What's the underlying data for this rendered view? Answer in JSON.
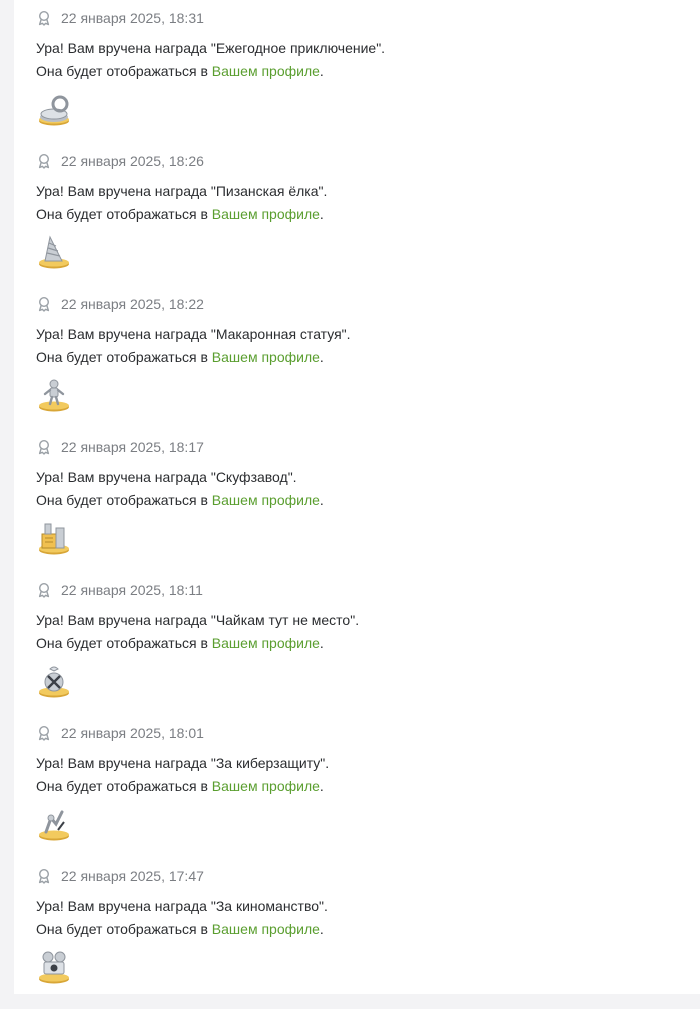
{
  "colors": {
    "link": "#5a9e2f",
    "date": "#7b7e83",
    "text": "#2b2d30",
    "page_bg": "#f3f3f5",
    "panel_bg": "#ffffff"
  },
  "notifications": [
    {
      "date": "22 января 2025, 18:31",
      "message": "Ура! Вам вручена награда \"Ежегодное приключение\".",
      "profile_prefix": "Она будет отображаться в ",
      "profile_link": "Вашем профиле",
      "profile_suffix": ".",
      "award_icon": "ring-award-icon"
    },
    {
      "date": "22 января 2025, 18:26",
      "message": "Ура! Вам вручена награда \"Пизанская ёлка\".",
      "profile_prefix": "Она будет отображаться в ",
      "profile_link": "Вашем профиле",
      "profile_suffix": ".",
      "award_icon": "tree-award-icon"
    },
    {
      "date": "22 января 2025, 18:22",
      "message": "Ура! Вам вручена награда \"Макаронная статуя\".",
      "profile_prefix": "Она будет отображаться в ",
      "profile_link": "Вашем профиле",
      "profile_suffix": ".",
      "award_icon": "statue-award-icon"
    },
    {
      "date": "22 января 2025, 18:17",
      "message": "Ура! Вам вручена награда \"Скуфзавод\".",
      "profile_prefix": "Она будет отображаться в ",
      "profile_link": "Вашем профиле",
      "profile_suffix": ".",
      "award_icon": "factory-award-icon"
    },
    {
      "date": "22 января 2025, 18:11",
      "message": "Ура! Вам вручена награда \"Чайкам тут не место\".",
      "profile_prefix": "Она будет отображаться в ",
      "profile_link": "Вашем профиле",
      "profile_suffix": ".",
      "award_icon": "seagull-award-icon"
    },
    {
      "date": "22 января 2025, 18:01",
      "message": "Ура! Вам вручена награда \"За киберзащиту\".",
      "profile_prefix": "Она будет отображаться в ",
      "profile_link": "Вашем профиле",
      "profile_suffix": ".",
      "award_icon": "cyber-award-icon"
    },
    {
      "date": "22 января 2025, 17:47",
      "message": "Ура! Вам вручена награда \"За киноманство\".",
      "profile_prefix": "Она будет отображаться в ",
      "profile_link": "Вашем профиле",
      "profile_suffix": ".",
      "award_icon": "film-camera-award-icon"
    }
  ]
}
